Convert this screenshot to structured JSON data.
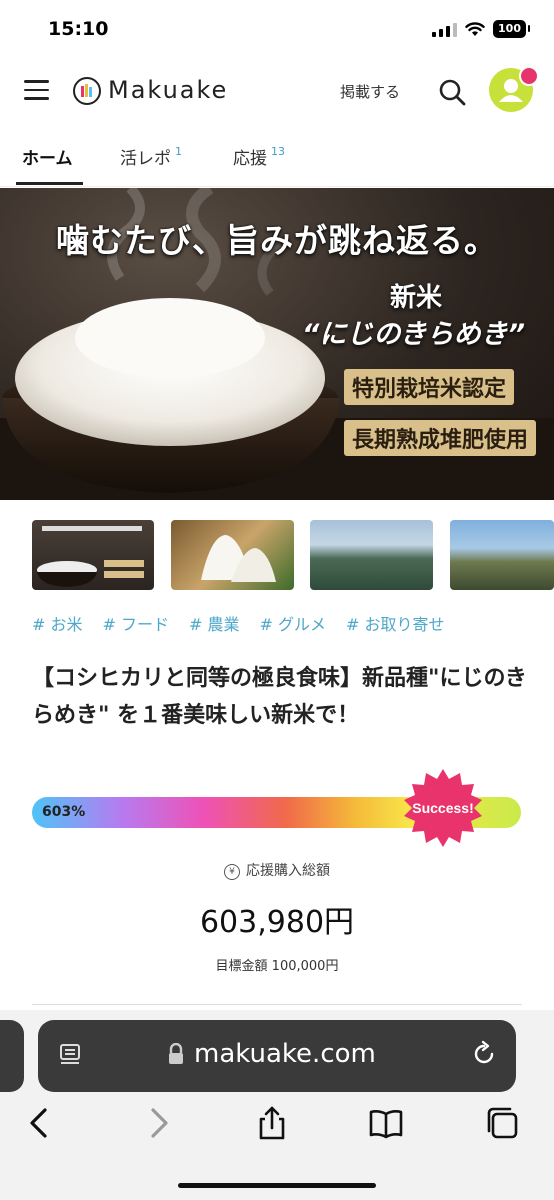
{
  "status_bar": {
    "time": "15:10",
    "battery": "100"
  },
  "header": {
    "logo_text": "Makuake",
    "post_link": "掲載する"
  },
  "tabs": [
    {
      "label": "ホーム",
      "count": ""
    },
    {
      "label": "活レポ",
      "count": "1"
    },
    {
      "label": "応援",
      "count": "13"
    }
  ],
  "hero": {
    "headline": "噛むたび、旨みが跳ね返る。",
    "sub1": "新米",
    "sub2": "“にじのきらめき”",
    "badge1": "特別栽培米認定",
    "badge2": "長期熟成堆肥使用"
  },
  "tags": [
    "# お米",
    "# フード",
    "# 農業",
    "# グルメ",
    "# お取り寄せ"
  ],
  "project": {
    "title": "【コシヒカリと同等の極良食味】新品種\"にじのきらめき\" を１番美味しい新米で！"
  },
  "funding": {
    "percent_label": "603%",
    "progress_percent": 603,
    "success_label": "Success!",
    "label": "応援購入総額",
    "amount": "603,980円",
    "goal": "目標金額 100,000円"
  },
  "browser": {
    "url": "makuake.com"
  },
  "colors": {
    "tag_blue": "#4fa8c9",
    "accent_pink": "#e8336d",
    "avatar_green": "#c8e03a"
  }
}
